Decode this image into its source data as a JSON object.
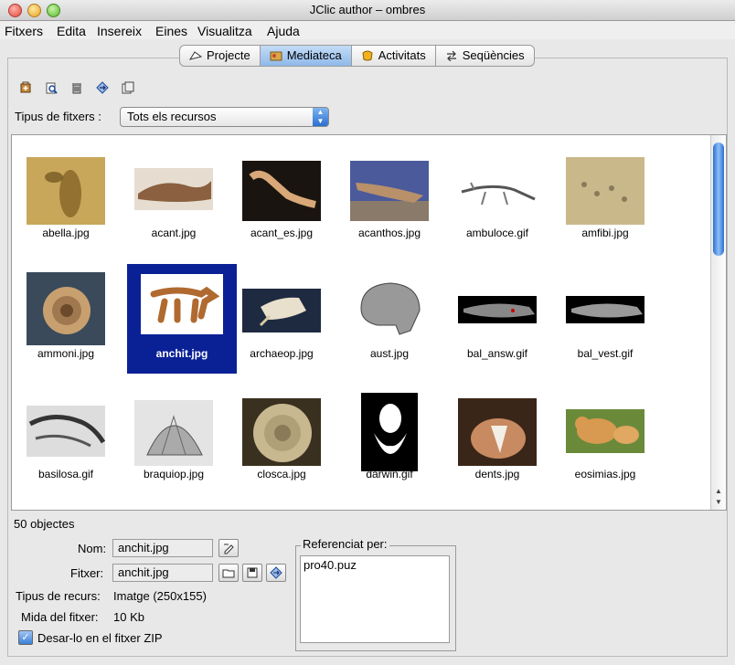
{
  "window": {
    "title": "JClic author – ombres"
  },
  "menu": [
    {
      "label": "Fitxers"
    },
    {
      "label": "Edita"
    },
    {
      "label": "Insereix"
    },
    {
      "label": "Eines"
    },
    {
      "label": "Visualitza"
    },
    {
      "label": "Ajuda"
    }
  ],
  "tabs": [
    {
      "label": "Projecte",
      "icon": "project-icon"
    },
    {
      "label": "Mediateca",
      "icon": "mediateca-icon",
      "active": true
    },
    {
      "label": "Activitats",
      "icon": "activities-icon"
    },
    {
      "label": "Seqüències",
      "icon": "sequences-icon"
    }
  ],
  "toolbar": [
    "add-media-icon",
    "preview-icon",
    "delete-icon",
    "update-icon",
    "copy-icon"
  ],
  "filter": {
    "label": "Tipus de fitxers :",
    "value": "Tots els recursos"
  },
  "files": [
    {
      "name": "abella.jpg"
    },
    {
      "name": "acant.jpg"
    },
    {
      "name": "acant_es.jpg"
    },
    {
      "name": "acanthos.jpg"
    },
    {
      "name": "ambuloce.gif"
    },
    {
      "name": "amfibi.jpg"
    },
    {
      "name": "ammoni.jpg"
    },
    {
      "name": "anchit.jpg",
      "selected": true
    },
    {
      "name": "archaeop.jpg"
    },
    {
      "name": "aust.jpg"
    },
    {
      "name": "bal_answ.gif"
    },
    {
      "name": "bal_vest.gif"
    },
    {
      "name": "basilosa.gif"
    },
    {
      "name": "braquiop.jpg"
    },
    {
      "name": "closca.jpg"
    },
    {
      "name": "darwin.gif"
    },
    {
      "name": "dents.jpg"
    },
    {
      "name": "eosimias.jpg"
    }
  ],
  "status": {
    "count": "50 objectes"
  },
  "details": {
    "name_label": "Nom:",
    "name_value": "anchit.jpg",
    "file_label": "Fitxer:",
    "file_value": "anchit.jpg",
    "type_label": "Tipus de recurs:",
    "type_value": "Imatge (250x155)",
    "size_label": "Mida del fitxer:",
    "size_value": "10 Kb",
    "zip_label": "Desar-lo en el fitxer ZIP",
    "zip_checked": true
  },
  "references": {
    "label": "Referenciat per:",
    "items": [
      "pro40.puz"
    ]
  }
}
